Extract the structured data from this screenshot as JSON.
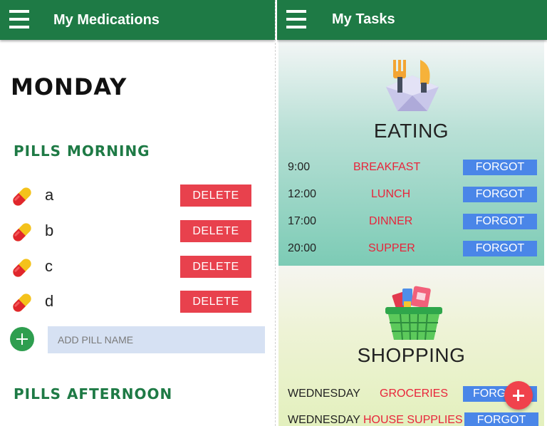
{
  "left_screen": {
    "app_title": "My Medications",
    "day": "MONDAY",
    "sections": [
      "PILLS MORNING",
      "PILLS AFTERNOON"
    ],
    "pills": [
      {
        "name": "a",
        "action": "DELETE"
      },
      {
        "name": "b",
        "action": "DELETE"
      },
      {
        "name": "c",
        "action": "DELETE"
      },
      {
        "name": "d",
        "action": "DELETE"
      }
    ],
    "add_input": {
      "placeholder": "ADD PILL NAME",
      "value": ""
    },
    "colors": {
      "appbar": "#1e7a45",
      "delete": "#e8414d",
      "add": "#2e9e4f"
    }
  },
  "right_screen": {
    "app_title": "My Tasks",
    "cards": [
      {
        "title": "EATING",
        "icon": "fork-knife-icon",
        "tasks": [
          {
            "time": "9:00",
            "name": "BREAKFAST",
            "action": "FORGOT"
          },
          {
            "time": "12:00",
            "name": "LUNCH",
            "action": "FORGOT"
          },
          {
            "time": "17:00",
            "name": "DINNER",
            "action": "FORGOT"
          },
          {
            "time": "20:00",
            "name": "SUPPER",
            "action": "FORGOT"
          }
        ]
      },
      {
        "title": "SHOPPING",
        "icon": "shopping-basket-icon",
        "tasks": [
          {
            "time": "WEDNESDAY",
            "name": "GROCERIES",
            "action": "FORG"
          },
          {
            "time": "WEDNESDAY",
            "name": "HOUSE SUPPLIES",
            "action": "FORGOT"
          }
        ]
      }
    ],
    "colors": {
      "task_name": "#e8243a",
      "forgot": "#4a86e8",
      "fab": "#f0424c"
    }
  }
}
